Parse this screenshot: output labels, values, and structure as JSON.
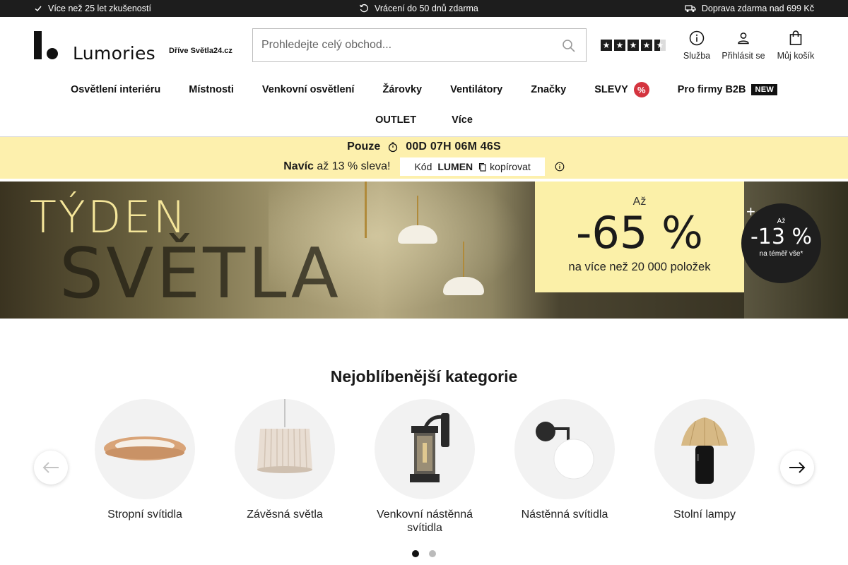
{
  "topbar": {
    "experience": "Více než 25 let zkušeností",
    "returns": "Vrácení do 50 dnů zdarma",
    "shipping": "Doprava zdarma nad 699 Kč"
  },
  "header": {
    "logo_text": "Lumories",
    "formerly": "Dříve Světla24.cz",
    "search_placeholder": "Prohledejte celý obchod...",
    "rating_stars": 4.5,
    "actions": {
      "service": "Služba",
      "login": "Přihlásit se",
      "cart": "Můj košík"
    }
  },
  "nav": {
    "row1": [
      "Osvětlení interiéru",
      "Místnosti",
      "Venkovní osvětlení",
      "Žárovky",
      "Ventilátory",
      "Značky",
      "SLEVY",
      "Pro firmy B2B"
    ],
    "sale_badge": "%",
    "new_badge": "NEW",
    "row2": [
      "OUTLET",
      "Více"
    ]
  },
  "promo": {
    "only": "Pouze",
    "countdown": "00D 07H 06M 46S",
    "extra_bold": "Navíc",
    "extra_text": "až 13 % sleva!",
    "code_label": "Kód",
    "code": "LUMEN",
    "copy_label": "kopírovat"
  },
  "hero": {
    "title1": "TÝDEN",
    "title2": "SVĚTLA",
    "offer_az": "Až",
    "offer_big": "-65 %",
    "offer_sub": "na více než 20 000 položek",
    "plus": "+",
    "circle_az": "Až",
    "circle_big": "-13 %",
    "circle_sub": "na téměř vše*"
  },
  "categories": {
    "title": "Nejoblíbenější kategorie",
    "items": [
      {
        "label": "Stropní svítidla"
      },
      {
        "label": "Závěsná světla"
      },
      {
        "label": "Venkovní nástěnná svítidla"
      },
      {
        "label": "Nástěnná svítidla"
      },
      {
        "label": "Stolní lampy"
      }
    ],
    "page": 1,
    "pages": 2
  }
}
